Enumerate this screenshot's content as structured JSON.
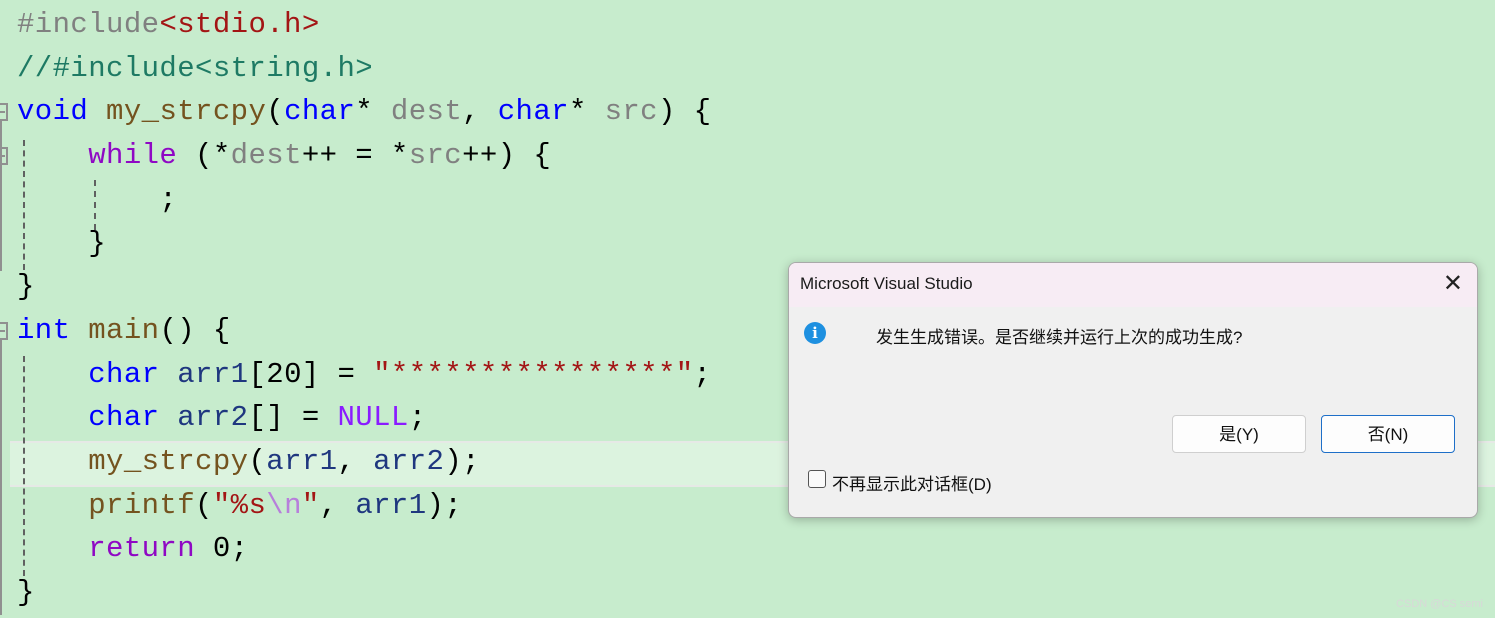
{
  "editor": {
    "highlighted_line": 11,
    "lines": [
      [
        [
          "t-pre",
          "#include"
        ],
        [
          "t-inc",
          "<stdio.h>"
        ]
      ],
      [
        [
          "t-com",
          "//#include<string.h>"
        ]
      ],
      [
        [
          "t-kw",
          "void"
        ],
        [
          "t-p",
          " "
        ],
        [
          "t-fn",
          "my_strcpy"
        ],
        [
          "t-p",
          "("
        ],
        [
          "t-kw",
          "char"
        ],
        [
          "t-p",
          "* "
        ],
        [
          "t-par",
          "dest"
        ],
        [
          "t-p",
          ", "
        ],
        [
          "t-kw",
          "char"
        ],
        [
          "t-p",
          "* "
        ],
        [
          "t-par",
          "src"
        ],
        [
          "t-p",
          ") {"
        ]
      ],
      [
        [
          "t-p",
          "    "
        ],
        [
          "t-ctl",
          "while"
        ],
        [
          "t-p",
          " (*"
        ],
        [
          "t-par",
          "dest"
        ],
        [
          "t-p",
          "++ = *"
        ],
        [
          "t-par",
          "src"
        ],
        [
          "t-p",
          "++) {"
        ]
      ],
      [
        [
          "t-p",
          "        ;"
        ]
      ],
      [
        [
          "t-p",
          "    }"
        ]
      ],
      [
        [
          "t-p",
          "}"
        ]
      ],
      [
        [
          "t-kw",
          "int"
        ],
        [
          "t-p",
          " "
        ],
        [
          "t-fn",
          "main"
        ],
        [
          "t-p",
          "() {"
        ]
      ],
      [
        [
          "t-p",
          "    "
        ],
        [
          "t-kw",
          "char"
        ],
        [
          "t-p",
          " "
        ],
        [
          "t-var",
          "arr1"
        ],
        [
          "t-p",
          "[20] = "
        ],
        [
          "t-str",
          "\"****************\""
        ],
        [
          "t-p",
          ";"
        ]
      ],
      [
        [
          "t-p",
          "    "
        ],
        [
          "t-kw",
          "char"
        ],
        [
          "t-p",
          " "
        ],
        [
          "t-var",
          "arr2"
        ],
        [
          "t-p",
          "[] = "
        ],
        [
          "t-mac",
          "NULL"
        ],
        [
          "t-p",
          ";"
        ]
      ],
      [
        [
          "t-p",
          "    "
        ],
        [
          "t-fn",
          "my_strcpy"
        ],
        [
          "t-p",
          "("
        ],
        [
          "t-var",
          "arr1"
        ],
        [
          "t-p",
          ", "
        ],
        [
          "t-var",
          "arr2"
        ],
        [
          "t-p",
          ");"
        ]
      ],
      [
        [
          "t-p",
          "    "
        ],
        [
          "t-fn",
          "printf"
        ],
        [
          "t-p",
          "("
        ],
        [
          "t-str",
          "\"%s"
        ],
        [
          "t-esc",
          "\\n"
        ],
        [
          "t-str",
          "\""
        ],
        [
          "t-p",
          ", "
        ],
        [
          "t-var",
          "arr1"
        ],
        [
          "t-p",
          ");"
        ]
      ],
      [
        [
          "t-p",
          "    "
        ],
        [
          "t-ctl",
          "return"
        ],
        [
          "t-p",
          " 0;"
        ]
      ],
      [
        [
          "t-p",
          "}"
        ]
      ]
    ]
  },
  "dialog": {
    "title": "Microsoft Visual Studio",
    "close_glyph": "✕",
    "icon": "info-icon",
    "message": "发生生成错误。是否继续并运行上次的成功生成?",
    "yes_label": "是(Y)",
    "no_label": "否(N)",
    "checkbox_label": "不再显示此对话框(D)",
    "checkbox_checked": false
  },
  "watermark": "CSDN @CS semi"
}
